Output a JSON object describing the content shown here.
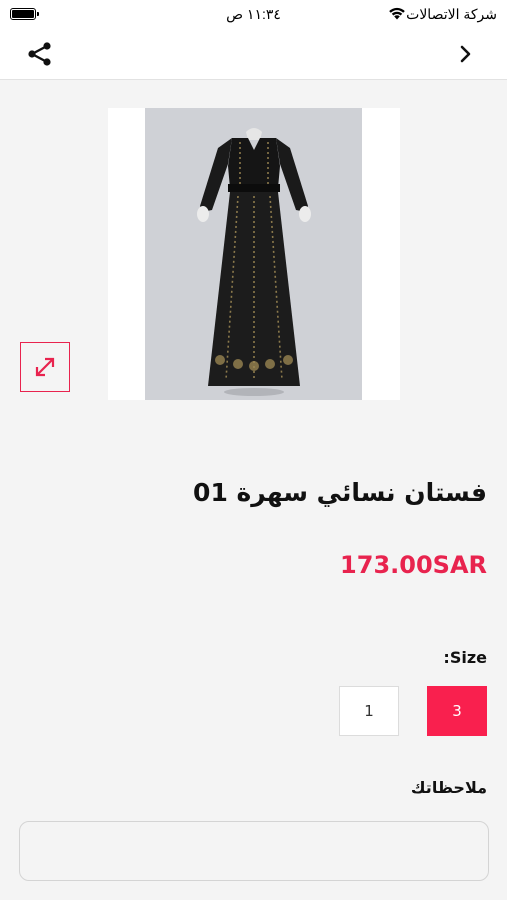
{
  "status_bar": {
    "carrier": "شركة الاتصالات",
    "time": "١١:٣٤ ص"
  },
  "nav": {
    "share_icon": "share-icon",
    "back_icon": "chevron-right-icon"
  },
  "product": {
    "image_description_icon": "dress-photo",
    "expand_icon": "expand-arrows-icon",
    "title": "فستان نسائي سهرة 01",
    "price": "173.00SAR"
  },
  "size": {
    "label": "Size:",
    "options": [
      {
        "label": "3",
        "selected": true
      },
      {
        "label": "1",
        "selected": false
      }
    ]
  },
  "notes": {
    "label": "ملاحظاتك",
    "value": "",
    "placeholder": ""
  },
  "colors": {
    "accent": "#f9204e",
    "background": "#f4f4f4",
    "text": "#111111"
  }
}
